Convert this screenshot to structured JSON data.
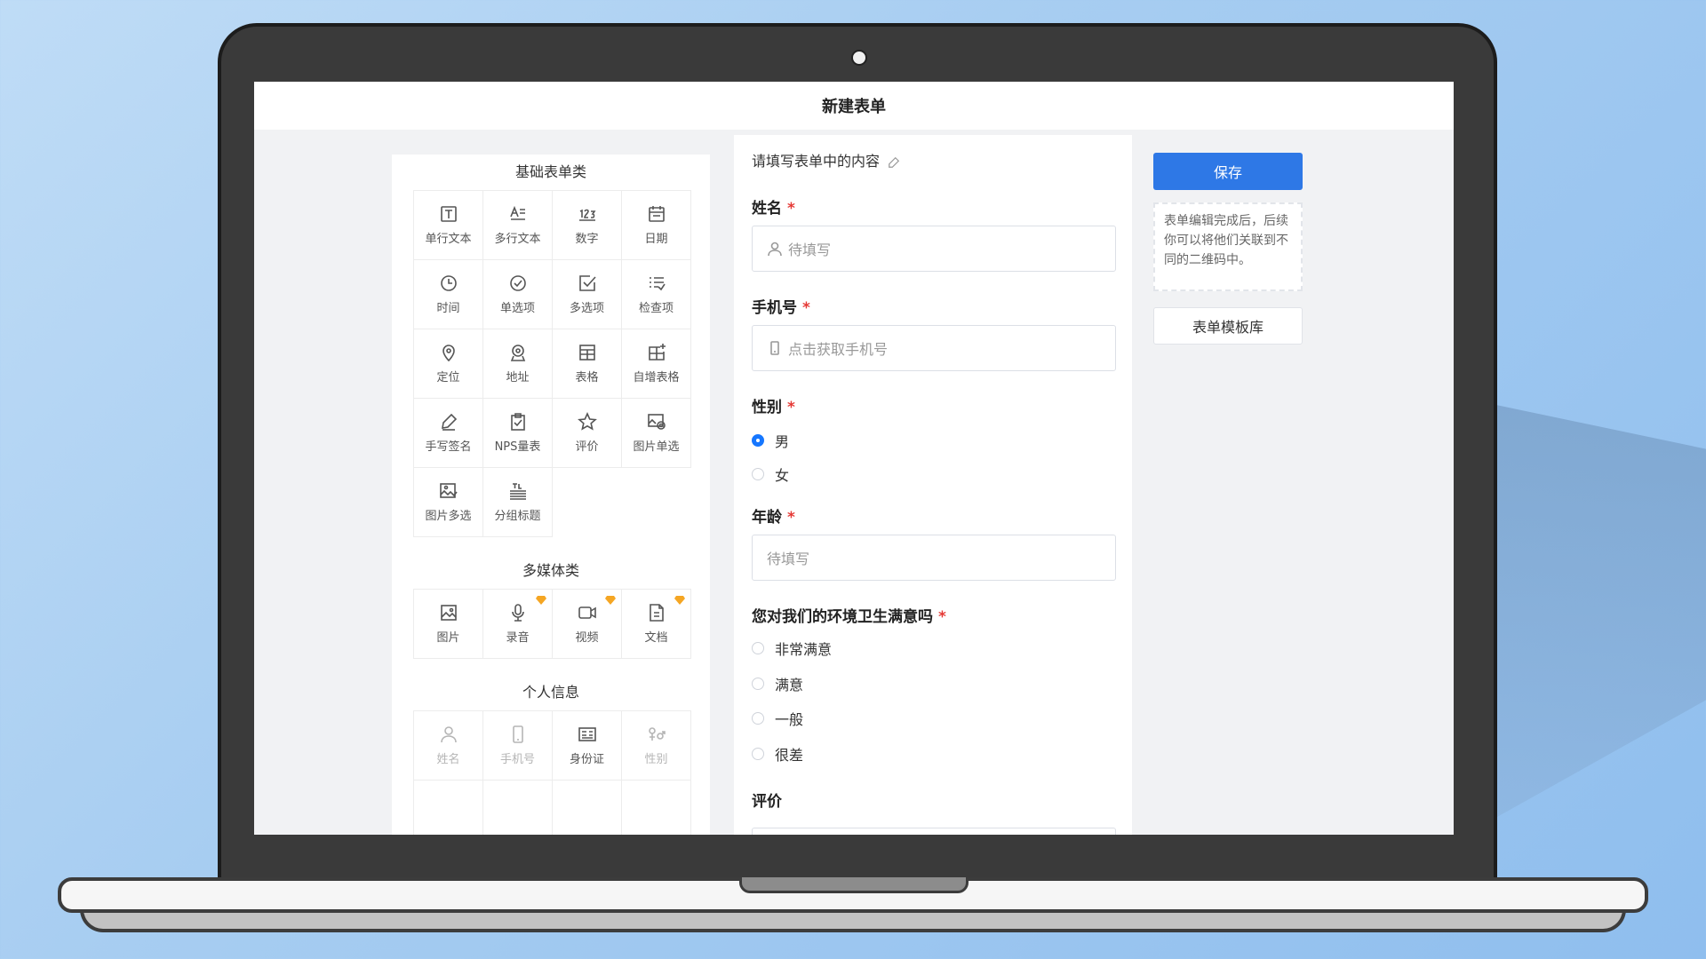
{
  "header": {
    "title": "新建表单"
  },
  "palette": {
    "basic": {
      "title": "基础表单类",
      "items": [
        {
          "label": "单行文本",
          "icon": "single-line-text-icon"
        },
        {
          "label": "多行文本",
          "icon": "multi-line-text-icon"
        },
        {
          "label": "数字",
          "icon": "number-icon"
        },
        {
          "label": "日期",
          "icon": "date-icon"
        },
        {
          "label": "时间",
          "icon": "clock-icon"
        },
        {
          "label": "单选项",
          "icon": "radio-check-icon"
        },
        {
          "label": "多选项",
          "icon": "checkbox-icon"
        },
        {
          "label": "检查项",
          "icon": "checklist-icon"
        },
        {
          "label": "定位",
          "icon": "location-pin-icon"
        },
        {
          "label": "地址",
          "icon": "address-icon"
        },
        {
          "label": "表格",
          "icon": "table-icon"
        },
        {
          "label": "自增表格",
          "icon": "table-add-icon"
        },
        {
          "label": "手写签名",
          "icon": "pen-icon"
        },
        {
          "label": "NPS量表",
          "icon": "nps-scale-icon"
        },
        {
          "label": "评价",
          "icon": "star-icon"
        },
        {
          "label": "图片单选",
          "icon": "image-single-select-icon"
        },
        {
          "label": "图片多选",
          "icon": "image-multi-select-icon"
        },
        {
          "label": "分组标题",
          "icon": "group-title-icon"
        }
      ]
    },
    "media": {
      "title": "多媒体类",
      "items": [
        {
          "label": "图片",
          "icon": "image-icon",
          "premium": false
        },
        {
          "label": "录音",
          "icon": "microphone-icon",
          "premium": true
        },
        {
          "label": "视频",
          "icon": "video-icon",
          "premium": true
        },
        {
          "label": "文档",
          "icon": "document-icon",
          "premium": true
        }
      ]
    },
    "personal": {
      "title": "个人信息",
      "items": [
        {
          "label": "姓名",
          "icon": "person-icon",
          "disabled": true
        },
        {
          "label": "手机号",
          "icon": "phone-icon",
          "disabled": true
        },
        {
          "label": "身份证",
          "icon": "id-card-icon",
          "disabled": false
        },
        {
          "label": "性别",
          "icon": "gender-icon",
          "disabled": true
        }
      ]
    }
  },
  "form": {
    "hint": "请填写表单中的内容",
    "name": {
      "label": "姓名",
      "required": "*",
      "placeholder": "待填写"
    },
    "phone": {
      "label": "手机号",
      "required": "*",
      "placeholder": "点击获取手机号"
    },
    "gender": {
      "label": "性别",
      "required": "*",
      "options": [
        "男",
        "女"
      ],
      "selected": "男"
    },
    "age": {
      "label": "年龄",
      "required": "*",
      "placeholder": "待填写"
    },
    "satisfaction": {
      "label": "您对我们的环境卫生满意吗",
      "required": "*",
      "options": [
        "非常满意",
        "满意",
        "一般",
        "很差"
      ]
    },
    "rating": {
      "label": "评价"
    }
  },
  "sidebar": {
    "save_label": "保存",
    "note": "表单编辑完成后，后续你可以将他们关联到不同的二维码中。",
    "template_label": "表单模板库"
  },
  "colors": {
    "accent": "#2e78e6",
    "required": "#e53935",
    "premium": "#f5a623"
  }
}
